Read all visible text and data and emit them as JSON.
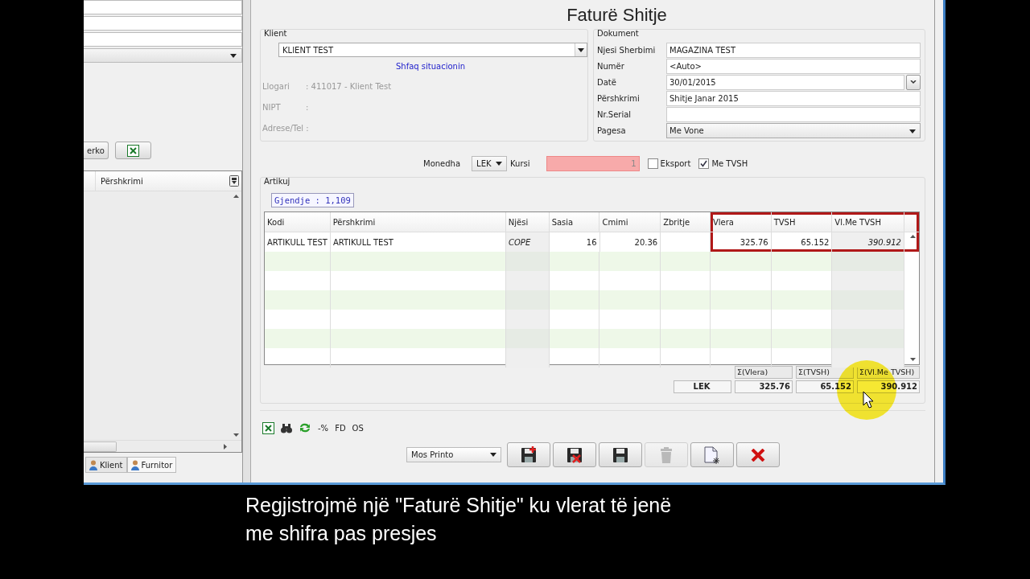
{
  "left_panel": {
    "search_button": "erko",
    "grid_columns": [
      "Përshkrimi"
    ],
    "tabs": [
      {
        "label": "Klient",
        "selected": false
      },
      {
        "label": "Furnitor",
        "selected": true
      }
    ]
  },
  "window": {
    "title": "Faturë Shitje"
  },
  "klient": {
    "group": "Klient",
    "value": "KLIENT TEST",
    "link": "Shfaq situacionin",
    "info": [
      {
        "label": "Llogari",
        "value": ": 411017 - Klient Test"
      },
      {
        "label": "NIPT",
        "value": ":"
      },
      {
        "label": "Adrese/Tel :"
      }
    ]
  },
  "dokument": {
    "group": "Dokument",
    "fields": [
      {
        "label": "Njesi Sherbimi",
        "value": "MAGAZINA TEST",
        "kind": "text"
      },
      {
        "label": "Numër",
        "value": "<Auto>",
        "kind": "text"
      },
      {
        "label": "Datë",
        "value": "30/01/2015",
        "kind": "date"
      },
      {
        "label": "Përshkrimi",
        "value": "Shitje Janar 2015",
        "kind": "text"
      },
      {
        "label": "Nr.Serial",
        "kind": "text"
      },
      {
        "label": "Pagesa",
        "value": "Me Vone",
        "kind": "select"
      }
    ]
  },
  "currency": {
    "label": "Monedha",
    "value": "LEK",
    "rate_label": "Kursi",
    "rate": "1",
    "checkboxes": [
      {
        "label": "Eksport",
        "checked": false
      },
      {
        "label": "Me TVSH",
        "checked": true
      }
    ]
  },
  "artikuj": {
    "group": "Artikuj",
    "stock": "Gjendje : 1,109",
    "columns": [
      {
        "label": "Kodi",
        "kind": "text",
        "readonly": false,
        "highlighted": false
      },
      {
        "label": "Përshkrimi",
        "kind": "text",
        "readonly": false,
        "highlighted": false
      },
      {
        "label": "Njësi",
        "kind": "text",
        "readonly": true,
        "highlighted": false
      },
      {
        "label": "Sasia",
        "kind": "number",
        "readonly": false,
        "highlighted": false
      },
      {
        "label": "Cmimi",
        "kind": "number",
        "readonly": false,
        "highlighted": false
      },
      {
        "label": "Zbritje",
        "kind": "number",
        "readonly": false,
        "highlighted": false
      },
      {
        "label": "Vlera",
        "kind": "number",
        "readonly": false,
        "highlighted": true
      },
      {
        "label": "TVSH",
        "kind": "number",
        "readonly": false,
        "highlighted": true
      },
      {
        "label": "Vl.Me TVSH",
        "kind": "number",
        "readonly": true,
        "highlighted": true
      }
    ],
    "rows": [
      [
        "ARTIKULL TEST",
        "ARTIKULL TEST",
        "COPE",
        "16",
        "20.36",
        "",
        "325.76",
        "65.152",
        "390.912"
      ]
    ]
  },
  "totals": {
    "currency": "LEK",
    "items": [
      {
        "label": "Σ(Vlera)",
        "value": "325.76"
      },
      {
        "label": "Σ(TVSH)",
        "value": "65.152"
      },
      {
        "label": "Σ(Vl.Me TVSH)",
        "value": "390.912"
      }
    ]
  },
  "tools": [
    {
      "kind": "excel"
    },
    {
      "kind": "binoculars"
    },
    {
      "kind": "refresh"
    },
    {
      "kind": "text",
      "label": "-%"
    },
    {
      "kind": "text",
      "label": "FD"
    },
    {
      "kind": "text",
      "label": "OS"
    }
  ],
  "print_select": "Mos Printo",
  "actions": [
    {
      "kind": "save-new",
      "disabled": false
    },
    {
      "kind": "save-delete",
      "disabled": false
    },
    {
      "kind": "save",
      "disabled": false
    },
    {
      "kind": "delete",
      "disabled": true
    },
    {
      "kind": "new-doc",
      "disabled": false
    },
    {
      "kind": "close",
      "disabled": false
    }
  ],
  "subtitle": [
    "Regjistrojmë një \"Faturë Shitje\" ku vlerat të jenë",
    "me shifra pas presjes"
  ]
}
